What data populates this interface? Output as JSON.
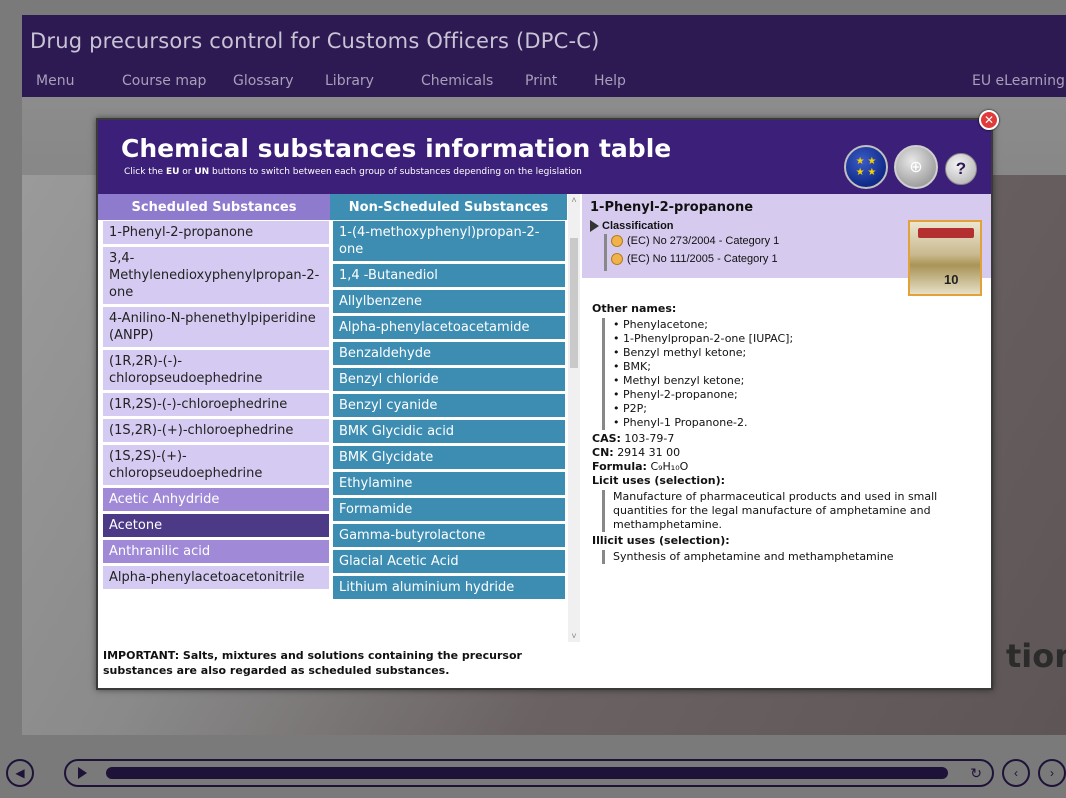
{
  "app": {
    "title": "Drug precursors control for Customs Officers (DPC-C)",
    "nav": [
      "Menu",
      "Course map",
      "Glossary",
      "Library",
      "Chemicals",
      "Print",
      "Help"
    ],
    "nav_right": "EU eLearning"
  },
  "background": {
    "partial_word": "tion"
  },
  "modal": {
    "title": "Chemical substances information table",
    "subtitle_pre": "Click the ",
    "subtitle_eu": "EU",
    "subtitle_mid": " or ",
    "subtitle_un": "UN",
    "subtitle_post": " buttons to switch between each group of substances depending on the legislation",
    "close_label": "✕",
    "help_label": "?",
    "scheduled_header": "Scheduled Substances",
    "non_scheduled_header": "Non-Scheduled Substances",
    "scheduled": [
      "1-Phenyl-2-propanone",
      "3,4-Methylenedioxyphenylpropan-2-one",
      "4-Anilino-N-phenethylpiperidine (ANPP)",
      "(1R,2R)-(-)-chloropseudoephedrine",
      "(1R,2S)-(-)-chloroephedrine",
      "(1S,2R)-(+)-chloroephedrine",
      "(1S,2S)-(+)-chloropseudoephedrine",
      "Acetic Anhydride",
      "Acetone",
      "Anthranilic acid",
      "Alpha-phenylacetoacetonitrile"
    ],
    "non_scheduled": [
      "1-(4-methoxyphenyl)propan-2-one",
      "1,4 -Butanediol",
      "Allylbenzene",
      "Alpha-phenylacetoacetamide",
      "Benzaldehyde",
      "Benzyl chloride",
      "Benzyl cyanide",
      "BMK Glycidic acid",
      "BMK Glycidate",
      "Ethylamine",
      "Formamide",
      "Gamma-butyrolactone",
      "Glacial Acetic Acid",
      "Lithium aluminium hydride"
    ],
    "important": "IMPORTANT: Salts, mixtures and solutions containing the precursor substances are also regarded as scheduled substances."
  },
  "detail": {
    "name": "1-Phenyl-2-propanone",
    "classification_label": "Classification",
    "classifications": [
      "(EC) No 273/2004 - Category 1",
      "(EC) No 111/2005 - Category 1"
    ],
    "photo_label": "10",
    "other_names_label": "Other names:",
    "other_names": [
      "• Phenylacetone;",
      "• 1-Phenylpropan-2-one [IUPAC];",
      "• Benzyl methyl ketone;",
      "• BMK;",
      "• Methyl benzyl ketone;",
      "• Phenyl-2-propanone;",
      "• P2P;",
      "• Phenyl-1 Propanone-2."
    ],
    "cas_label": "CAS:",
    "cas": "103-79-7",
    "cn_label": "CN:",
    "cn": "2914 31 00",
    "formula_label": "Formula:",
    "formula": "C₉H₁₀O",
    "licit_label": "Licit uses (selection):",
    "licit": "Manufacture of pharmaceutical products and used in small quantities for the legal manufacture of amphetamine and methamphetamine.",
    "illicit_label": "Illicit uses (selection):",
    "illicit": "Synthesis of amphetamine and methamphetamine"
  }
}
